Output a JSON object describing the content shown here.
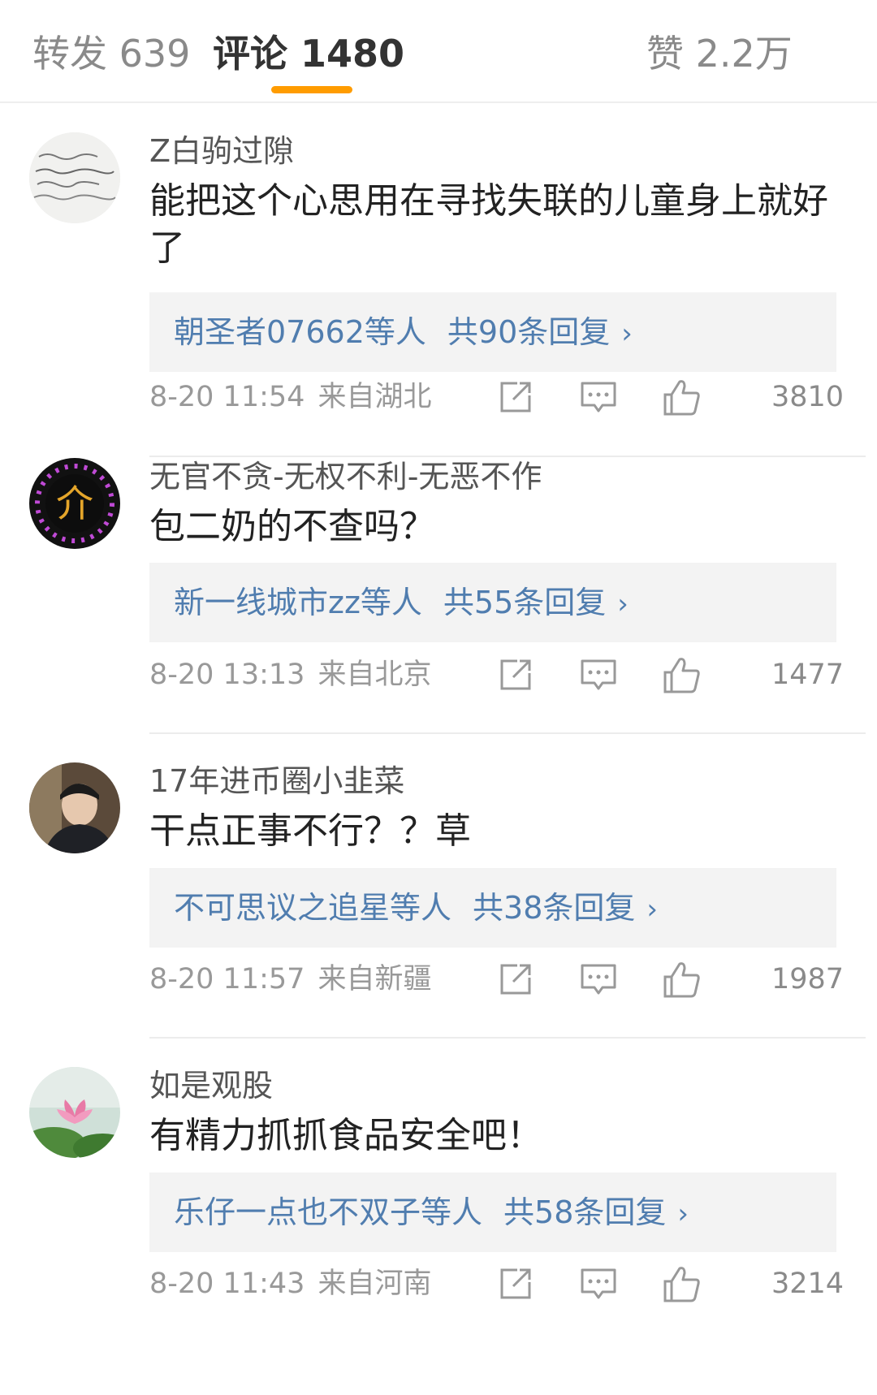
{
  "tabs": [
    {
      "label": "转发 639"
    },
    {
      "label": "评论 1480"
    },
    {
      "label": "赞 2.2万"
    }
  ],
  "comments": [
    {
      "username": "Z白驹过隙",
      "text": "能把这个心思用在寻找失联的儿童身上就好了",
      "reply_preview": {
        "users": "朝圣者07662等人",
        "count": "共90条回复",
        "chevron": "›"
      },
      "time": "8-20 11:54",
      "location": "来自湖北",
      "likes": "3810"
    },
    {
      "username": "无官不贪-无权不利-无恶不作",
      "text": "包二奶的不查吗？",
      "reply_preview": {
        "users": "新一线城市zz等人",
        "count": "共55条回复",
        "chevron": "›"
      },
      "time": "8-20 13:13",
      "location": "来自北京",
      "likes": "1477"
    },
    {
      "username": "17年进币圈小韭菜",
      "text": "干点正事不行？？草",
      "reply_preview": {
        "users": "不可思议之追星等人",
        "count": "共38条回复",
        "chevron": "›"
      },
      "time": "8-20 11:57",
      "location": "来自新疆",
      "likes": "1987"
    },
    {
      "username": "如是观股",
      "text": "有精力抓抓食品安全吧！",
      "reply_preview": {
        "users": "乐仔一点也不双子等人",
        "count": "共58条回复",
        "chevron": "›"
      },
      "time": "8-20 11:43",
      "location": "来自河南",
      "likes": "3214"
    }
  ],
  "avatar2_glyph": "介",
  "colors": {
    "accent": "#ff9c00",
    "link": "#507daf",
    "meta": "#999999",
    "reply_bg": "#f3f3f3"
  },
  "icons": {
    "repost": "share-square-icon",
    "reply": "comment-bubble-icon",
    "like": "thumbs-up-icon"
  }
}
